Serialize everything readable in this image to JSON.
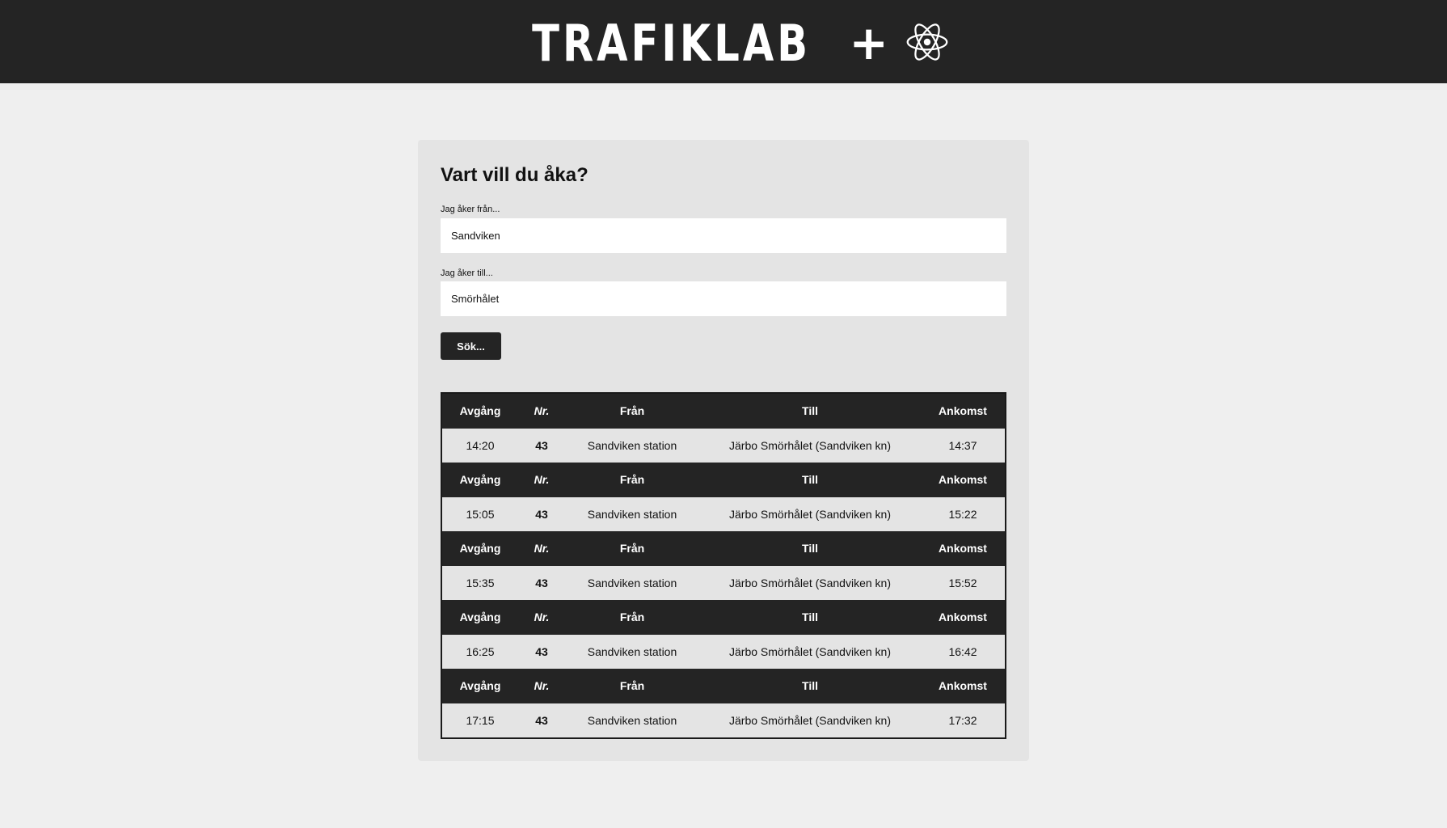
{
  "header": {
    "logo_text": "TRAFIKLAB",
    "logo_plus": "+",
    "logo_icon": "react-atom-icon"
  },
  "form": {
    "title": "Vart vill du åka?",
    "from_label": "Jag åker från...",
    "from_value": "Sandviken",
    "to_label": "Jag åker till...",
    "to_value": "Smörhålet",
    "search_label": "Sök..."
  },
  "results": {
    "headers": {
      "departure": "Avgång",
      "number": "Nr.",
      "from": "Från",
      "to": "Till",
      "arrival": "Ankomst"
    },
    "trips": [
      {
        "departure": "14:20",
        "number": "43",
        "from": "Sandviken station",
        "to": "Järbo Smörhålet (Sandviken kn)",
        "arrival": "14:37"
      },
      {
        "departure": "15:05",
        "number": "43",
        "from": "Sandviken station",
        "to": "Järbo Smörhålet (Sandviken kn)",
        "arrival": "15:22"
      },
      {
        "departure": "15:35",
        "number": "43",
        "from": "Sandviken station",
        "to": "Järbo Smörhålet (Sandviken kn)",
        "arrival": "15:52"
      },
      {
        "departure": "16:25",
        "number": "43",
        "from": "Sandviken station",
        "to": "Järbo Smörhålet (Sandviken kn)",
        "arrival": "16:42"
      },
      {
        "departure": "17:15",
        "number": "43",
        "from": "Sandviken station",
        "to": "Järbo Smörhålet (Sandviken kn)",
        "arrival": "17:32"
      }
    ]
  },
  "colors": {
    "header_bg": "#242424",
    "page_bg": "#efefef",
    "card_bg": "#e4e4e4"
  }
}
